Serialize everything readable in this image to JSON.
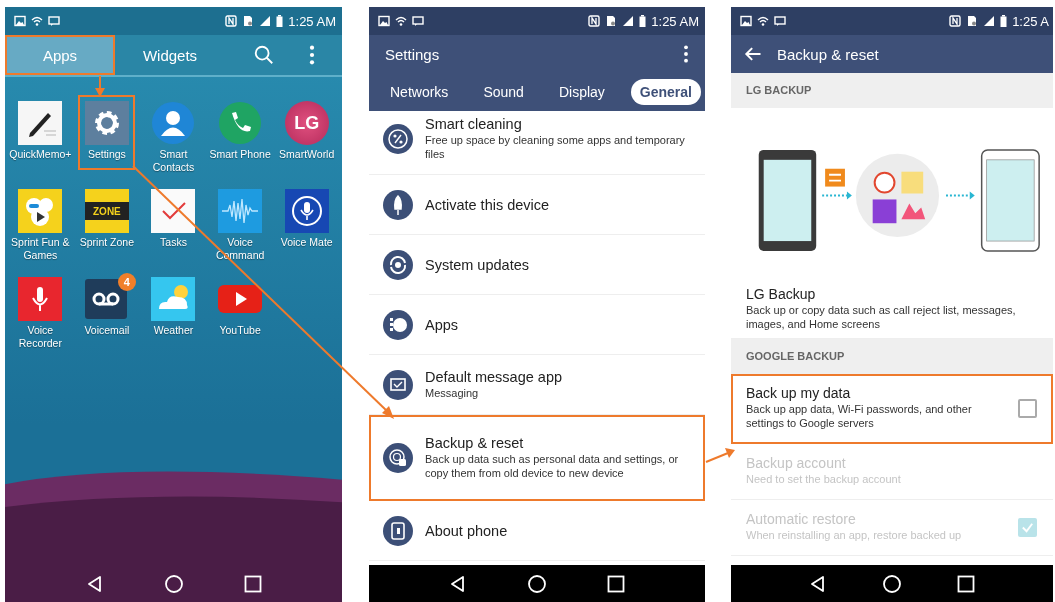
{
  "screens": [
    {
      "kind": "launcher",
      "status_time": "1:25 AM",
      "tabs": [
        {
          "label": "Apps",
          "selected": true,
          "highlighted": true
        },
        {
          "label": "Widgets",
          "selected": false,
          "highlighted": false
        }
      ],
      "apps": [
        {
          "label": "QuickMemo+",
          "highlighted": false
        },
        {
          "label": "Settings",
          "highlighted": true
        },
        {
          "label": "Smart Contacts",
          "highlighted": false
        },
        {
          "label": "Smart Phone",
          "highlighted": false
        },
        {
          "label": "SmartWorld",
          "highlighted": false,
          "icon_text": "LG"
        },
        {
          "label": "Sprint Fun & Games",
          "highlighted": false
        },
        {
          "label": "Sprint Zone",
          "highlighted": false,
          "icon_text": "ZONE"
        },
        {
          "label": "Tasks",
          "highlighted": false
        },
        {
          "label": "Voice Command",
          "highlighted": false
        },
        {
          "label": "Voice Mate",
          "highlighted": false
        },
        {
          "label": "Voice Recorder",
          "highlighted": false
        },
        {
          "label": "Voicemail",
          "highlighted": false,
          "badge": "4"
        },
        {
          "label": "Weather",
          "highlighted": false
        },
        {
          "label": "YouTube",
          "highlighted": false
        }
      ]
    },
    {
      "kind": "settings",
      "status_time": "1:25 AM",
      "title": "Settings",
      "tabs": [
        {
          "label": "Networks",
          "selected": false
        },
        {
          "label": "Sound",
          "selected": false
        },
        {
          "label": "Display",
          "selected": false
        },
        {
          "label": "General",
          "selected": true
        }
      ],
      "items": [
        {
          "title": "Smart cleaning",
          "subtitle": "Free up space by cleaning some apps and temporary files",
          "highlighted": false
        },
        {
          "title": "Activate this device",
          "highlighted": false
        },
        {
          "title": "System updates",
          "highlighted": false
        },
        {
          "title": "Apps",
          "highlighted": false
        },
        {
          "title": "Default message app",
          "subtitle": "Messaging",
          "highlighted": false
        },
        {
          "title": "Backup & reset",
          "subtitle": "Back up data such as personal data and settings, or copy them from old device to new device",
          "highlighted": true
        },
        {
          "title": "About phone",
          "highlighted": false
        }
      ]
    },
    {
      "kind": "backup",
      "status_time": "1:25 A",
      "title": "Backup & reset",
      "sections": [
        {
          "header": "LG BACKUP",
          "items": [
            {
              "kind": "illustration"
            },
            {
              "kind": "text",
              "title": "LG Backup",
              "subtitle": "Back up or copy data such as call reject list, messages, images, and Home screens",
              "disabled": false,
              "highlighted": false
            }
          ]
        },
        {
          "header": "GOOGLE BACKUP",
          "items": [
            {
              "kind": "checkbox",
              "title": "Back up my data",
              "subtitle": "Back up app data, Wi-Fi passwords, and other settings to Google servers",
              "checked": false,
              "disabled": false,
              "highlighted": true
            },
            {
              "kind": "text",
              "title": "Backup account",
              "subtitle": "Need to set the backup account",
              "disabled": true,
              "highlighted": false
            },
            {
              "kind": "checkbox",
              "title": "Automatic restore",
              "subtitle": "When reinstalling an app, restore backed up",
              "checked": true,
              "disabled": true,
              "highlighted": false
            }
          ]
        }
      ]
    }
  ]
}
